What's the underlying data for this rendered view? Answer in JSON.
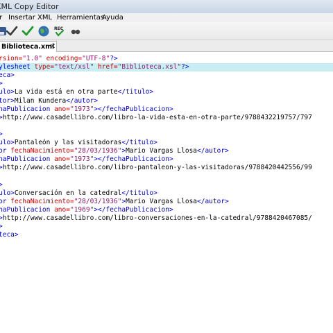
{
  "window": {
    "title": "XML Copy Editor"
  },
  "menu": {
    "items": [
      "r",
      "Insertar",
      "XML",
      "Herramientas",
      "Ayuda"
    ]
  },
  "toolbar": {
    "icons": [
      "save-icon",
      "check-well-formed-icon",
      "validate-icon",
      "browser-globe-icon",
      "record-macro-icon",
      "play-macro-icon"
    ]
  },
  "tab": {
    "label": "Biblioteca.xml",
    "close": "✕"
  },
  "colors": {
    "tag": "#0000d8",
    "attribute": "#d40000",
    "value": "#8b1a6b",
    "highlight": "#c8eef4"
  },
  "editor": {
    "lines": [
      {
        "segs": [
          {
            "c": "attr",
            "t": "rsion="
          },
          {
            "c": "val",
            "t": "\"1.0\""
          },
          {
            "c": "txt",
            "t": " "
          },
          {
            "c": "attr",
            "t": "encoding="
          },
          {
            "c": "val",
            "t": "\"UTF-8\""
          },
          {
            "c": "tag",
            "t": "?>"
          }
        ]
      },
      {
        "hl": true,
        "segs": [
          {
            "c": "tag",
            "t": "ylesheet "
          },
          {
            "c": "attr",
            "t": "type="
          },
          {
            "c": "val",
            "t": "\"text/xsl\""
          },
          {
            "c": "txt",
            "t": " "
          },
          {
            "c": "attr",
            "t": "href="
          },
          {
            "c": "val",
            "t": "\"Biblioteca.xsl\""
          },
          {
            "c": "tag",
            "t": "?>"
          }
        ]
      },
      {
        "segs": [
          {
            "c": "tag",
            "t": "eca>"
          }
        ]
      },
      {
        "segs": [
          {
            "c": "tag",
            "t": ">"
          }
        ]
      },
      {
        "segs": [
          {
            "c": "tag",
            "t": "ulo>"
          },
          {
            "c": "txt",
            "t": "La vida está en otra parte"
          },
          {
            "c": "tag",
            "t": "</titulo>"
          }
        ]
      },
      {
        "segs": [
          {
            "c": "tag",
            "t": "tor>"
          },
          {
            "c": "txt",
            "t": "Milan Kundera"
          },
          {
            "c": "tag",
            "t": "</autor>"
          }
        ]
      },
      {
        "segs": [
          {
            "c": "tag",
            "t": "haPublicacion "
          },
          {
            "c": "attr",
            "t": "ano="
          },
          {
            "c": "val",
            "t": "\"1973\""
          },
          {
            "c": "tag",
            "t": "></fechaPublicacion>"
          }
        ]
      },
      {
        "segs": [
          {
            "c": "tag",
            "t": ">"
          },
          {
            "c": "txt",
            "t": "http://www.casadellibro.com/libro-la-vida-esta-en-otra-parte/9788432219757/797"
          }
        ]
      },
      {
        "segs": []
      },
      {
        "segs": [
          {
            "c": "tag",
            "t": ">"
          }
        ]
      },
      {
        "segs": [
          {
            "c": "tag",
            "t": "ulo>"
          },
          {
            "c": "txt",
            "t": "Pantaleón y las visitadoras"
          },
          {
            "c": "tag",
            "t": "</titulo>"
          }
        ]
      },
      {
        "segs": [
          {
            "c": "tag",
            "t": "or "
          },
          {
            "c": "attr",
            "t": "fechaNacimiento="
          },
          {
            "c": "val",
            "t": "\"28/03/1936\""
          },
          {
            "c": "tag",
            "t": ">"
          },
          {
            "c": "txt",
            "t": "Mario Vargas Llosa"
          },
          {
            "c": "tag",
            "t": "</autor>"
          }
        ]
      },
      {
        "segs": [
          {
            "c": "tag",
            "t": "haPublicacion "
          },
          {
            "c": "attr",
            "t": "ano="
          },
          {
            "c": "val",
            "t": "\"1973\""
          },
          {
            "c": "tag",
            "t": "></fechaPublicacion>"
          }
        ]
      },
      {
        "segs": [
          {
            "c": "tag",
            "t": ">"
          },
          {
            "c": "txt",
            "t": "http://www.casadellibro.com/libro-pantaleon-y-las-visitadoras/9788420442556/99"
          }
        ]
      },
      {
        "segs": []
      },
      {
        "segs": [
          {
            "c": "tag",
            "t": ">"
          }
        ]
      },
      {
        "segs": [
          {
            "c": "tag",
            "t": "ulo>"
          },
          {
            "c": "txt",
            "t": "Conversación en la catedral"
          },
          {
            "c": "tag",
            "t": "</titulo>"
          }
        ]
      },
      {
        "segs": [
          {
            "c": "tag",
            "t": "or "
          },
          {
            "c": "attr",
            "t": "fechaNacimiento="
          },
          {
            "c": "val",
            "t": "\"28/03/1936\""
          },
          {
            "c": "tag",
            "t": ">"
          },
          {
            "c": "txt",
            "t": "Mario Vargas Llosa"
          },
          {
            "c": "tag",
            "t": "</autor>"
          }
        ]
      },
      {
        "segs": [
          {
            "c": "tag",
            "t": "haPublicacion "
          },
          {
            "c": "attr",
            "t": "ano="
          },
          {
            "c": "val",
            "t": "\"1969\""
          },
          {
            "c": "tag",
            "t": "></fechaPublicacion>"
          }
        ]
      },
      {
        "segs": [
          {
            "c": "tag",
            "t": ">"
          },
          {
            "c": "txt",
            "t": "http://www.casadellibro.com/libro-conversaciones-en-la-catedral/9788420467085/"
          }
        ]
      },
      {
        "segs": [
          {
            "c": "tag",
            "t": ">"
          }
        ]
      },
      {
        "segs": [
          {
            "c": "tag",
            "t": "teca>"
          }
        ]
      }
    ]
  }
}
